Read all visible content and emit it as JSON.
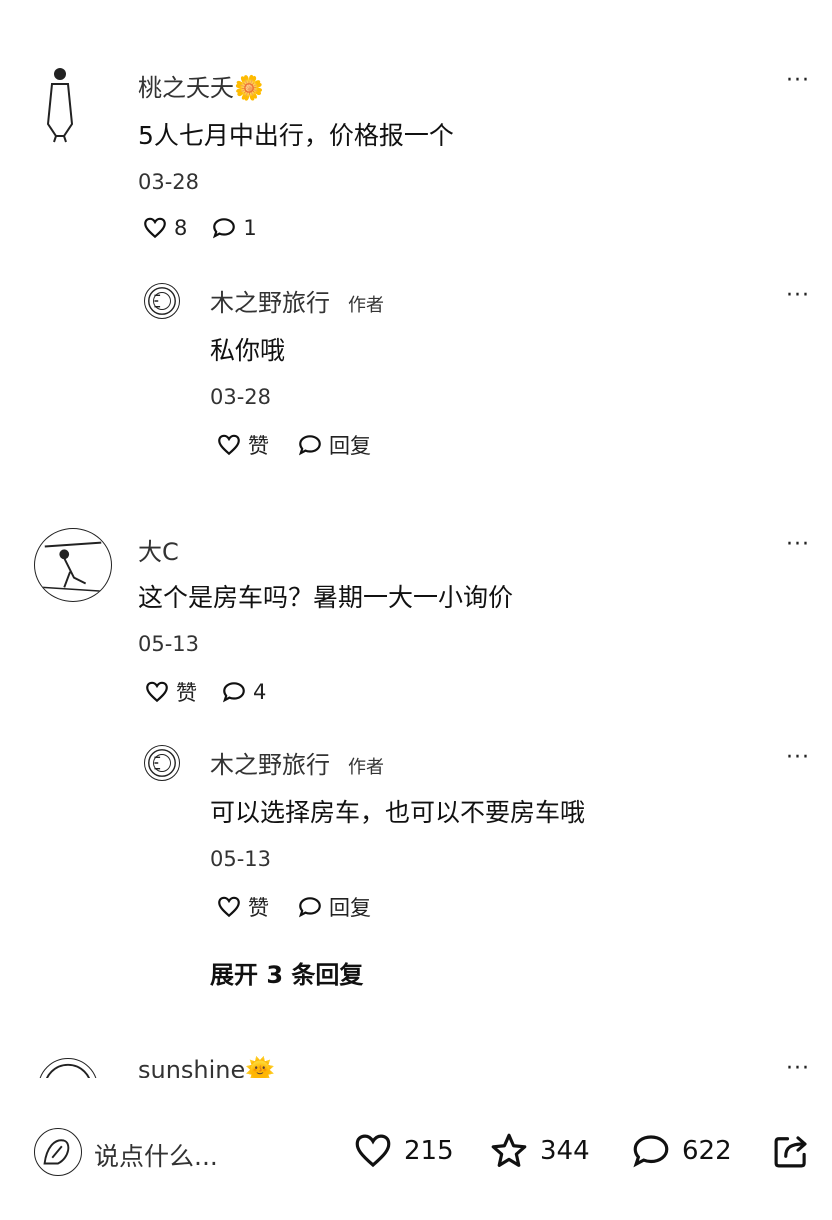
{
  "comments": [
    {
      "author": "桃之夭夭🌼",
      "text": "5人七月中出行，价格报一个",
      "date": "03-28",
      "likes": "8",
      "replies_count": "1",
      "reply": {
        "author": "木之野旅行",
        "tag": "作者",
        "text": "私你哦",
        "date": "03-28",
        "like_label": "赞",
        "reply_label": "回复"
      }
    },
    {
      "author": "大C",
      "text": "这个是房车吗？暑期一大一小询价",
      "date": "05-13",
      "likes": "赞",
      "replies_count": "4",
      "reply": {
        "author": "木之野旅行",
        "tag": "作者",
        "text": "可以选择房车，也可以不要房车哦",
        "date": "05-13",
        "like_label": "赞",
        "reply_label": "回复"
      },
      "expand": "展开 3 条回复"
    },
    {
      "author": "sunshine🌞"
    }
  ],
  "more_label": "···",
  "bottom_bar": {
    "placeholder": "说点什么...",
    "likes": "215",
    "stars": "344",
    "comments": "622"
  },
  "icons": [
    "heart-icon",
    "comment-icon",
    "star-icon",
    "share-icon",
    "more-icon"
  ]
}
